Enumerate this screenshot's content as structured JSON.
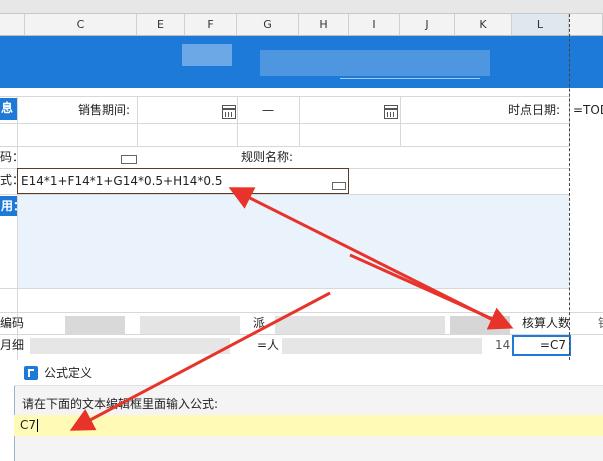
{
  "columns": [
    "C",
    "E",
    "F",
    "G",
    "H",
    "I",
    "J",
    "K",
    "L"
  ],
  "selected_column": "L",
  "sheet": {
    "left_cut_labels": [
      "息",
      "码：",
      "式：",
      "用："
    ],
    "sales_period_label": "销售期间:",
    "dash": "—",
    "point_date_label": "时点日期:",
    "point_date_value": "=TOD",
    "rule_name_label": "规则名称:",
    "formula_value": "E14*1+F14*1+G14*0.5+H14*0.5",
    "row_label_code": "编码",
    "row_label_detail": "月细",
    "middle_label": "派",
    "accounting_label": "核算人数",
    "accounting_value": "=C7",
    "partial_cell_value": "=人",
    "partial_cell_value2": "14"
  },
  "dialog": {
    "title": "公式定义",
    "prompt": "请在下面的文本编辑框里面输入公式:",
    "input_value": "C7"
  },
  "colors": {
    "banner": "#1d7ad8",
    "arrow": "#e8332b",
    "input_highlight": "#fffbb7"
  }
}
